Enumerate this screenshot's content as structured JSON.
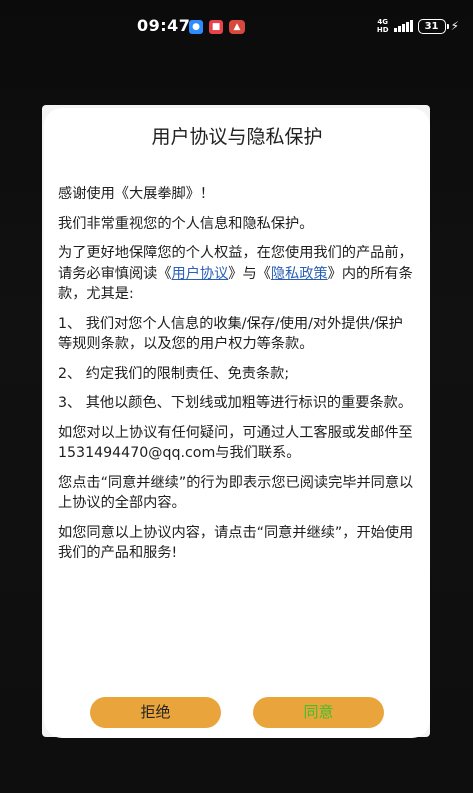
{
  "status_bar": {
    "time": "09:47",
    "network": "4G",
    "network_sub": "HD",
    "battery": "31",
    "icons": [
      "chat-app-icon",
      "notification-app-icon",
      "game-app-icon",
      "signal-icon",
      "battery-icon",
      "charging-icon"
    ]
  },
  "dialog": {
    "title": "用户协议与隐私保护",
    "greeting": "感谢使用《大展拳脚》！",
    "p1": "我们非常重视您的个人信息和隐私保护。",
    "p2_start": "为了更好地保障您的个人权益，在您使用我们的产品前，请务必审慎阅读《",
    "link_user_agreement": "用户协议",
    "p2_middle": "》与《",
    "link_privacy_policy": "隐私政策",
    "p2_end": "》内的所有条款，尤其是:",
    "item1": "1、 我们对您个人信息的收集/保存/使用/对外提供/保护等规则条款，以及您的用户权力等条款。",
    "item2": "2、 约定我们的限制责任、免责条款;",
    "item3": "3、 其他以颜色、下划线或加粗等进行标识的重要条款。",
    "contact": "如您对以上协议有任何疑问，可通过人工客服或发邮件至1531494470@qq.com与我们联系。",
    "notice": "您点击“同意并继续”的行为即表示您已阅读完毕并同意以上协议的全部内容。",
    "prompt": "如您同意以上协议内容，请点击“同意并继续”，开始使用我们的产品和服务!",
    "reject_label": "拒绝",
    "agree_label": "同意"
  },
  "colors": {
    "button_bg": "#e9a53c",
    "agree_text": "#3fbf2c",
    "link": "#2a5fb8"
  }
}
